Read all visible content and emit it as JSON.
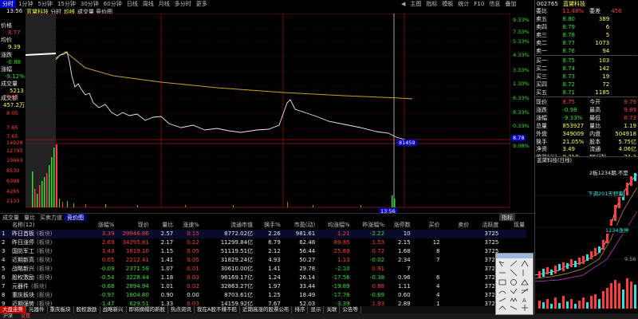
{
  "period_tabs": [
    "分时",
    "1分钟",
    "5分钟",
    "15分钟",
    "30分钟",
    "60分钟",
    "日线",
    "周线",
    "月线",
    "多分时",
    "更多"
  ],
  "toolbar_right": [
    "主图",
    "指标",
    "模板",
    "统计",
    "F10",
    "信息",
    "叠加"
  ],
  "title_row": {
    "time": "13:56",
    "stock_name": "蓝黛科技",
    "tab1": "分时",
    "tab2": "均线",
    "tab3": "成交量",
    "tab4": "竞价图"
  },
  "left_panel": {
    "price_label": "价格",
    "price_val": "8.77",
    "avg_label": "均价",
    "avg_val": "9.39",
    "chg_label": "涨跌",
    "chg_val": "-0.88",
    "pct_label": "涨幅",
    "pct_val": "-9.12%",
    "vol_label": "成交量",
    "vol_val": "5213",
    "amt_label": "成交额",
    "amt_val": "457.2万"
  },
  "price_axis_left": [
    "9.68",
    "9.47",
    "9.27",
    "9.07",
    "8.86",
    "8.66",
    "8.46",
    "8.26",
    "8.05",
    "7.85",
    "7.65"
  ],
  "price_axis_right": [
    "0.33%",
    "1.30%",
    "3.33%",
    "4.33%",
    "5.33%",
    "6.33%",
    "7.33%",
    "8.33%",
    "9.33%"
  ],
  "cur_price_tag": "8.78",
  "cur_pct_tag": "9.08%",
  "vol_axis": [
    "14928",
    "12795",
    "10663",
    "8530",
    "6398",
    "4265",
    "2133"
  ],
  "time_ticks": [
    "10:30",
    "13:00",
    "14:00",
    "15:00"
  ],
  "cursor_time": "13:56",
  "cursor_vol": "81459",
  "bottom_tabs": [
    "成交量",
    "量比",
    "买卖力道",
    "竞价图"
  ],
  "indicator_btn": "指标",
  "table": {
    "headers": [
      "名称(12)",
      "涨幅%",
      "现价",
      "量比",
      "涨速%",
      "流通市值",
      "换手%",
      "市盈(动)",
      "均涨幅%",
      "昨涨幅%",
      "涨停数",
      "买价",
      "卖价",
      "活跃度",
      "现量"
    ],
    "rows": [
      [
        "昨日首板",
        "(板块)",
        "3.39",
        "29946.86",
        "2.57",
        "0.15",
        "8772.02亿",
        "2.26",
        "981.61",
        "1.21",
        "-2.22",
        "10",
        "",
        "",
        "3725"
      ],
      [
        "昨日涨停",
        "(板块)",
        "2.69",
        "34295.81",
        "2.17",
        "0.12",
        "11299.84亿",
        "6.79",
        "62.48",
        "89.85",
        "1.53",
        "2.15",
        "12",
        "",
        "3725"
      ],
      [
        "国防军工",
        "(板块)",
        "1.43",
        "1819.10",
        "1.15",
        "0.05",
        "51119.51亿",
        "2.12",
        "56.44",
        "25.69",
        "0.72",
        "1.68",
        "8",
        "",
        "3725"
      ],
      [
        "近期新高",
        "(板块)",
        "0.05",
        "2212.41",
        "1.41",
        "0.05",
        "31829.24亿",
        "4.93",
        "50.27",
        "1.13",
        "-0.02",
        "2.34",
        "7",
        "",
        "3725"
      ],
      [
        "战略新兴",
        "(板块)",
        "-0.09",
        "2371.59",
        "1.07",
        "0.01",
        "30610.00亿",
        "1.41",
        "29.78",
        "-2.10",
        "0.91",
        "7",
        "",
        "",
        "3725"
      ],
      [
        "股权激励",
        "(板块)",
        "-0.54",
        "3228.44",
        "1.18",
        "0.03",
        "96169.17亿",
        "1.24",
        "26.14",
        "-17.56",
        "-0.38",
        "0.96",
        "6",
        "",
        "3725"
      ],
      [
        "元器件",
        "(板块)",
        "-0.68",
        "2894.94",
        "1.01",
        "0.02",
        "32863.27亿",
        "1.97",
        "33.44",
        "-19.89",
        "0.88",
        "1.11",
        "4",
        "",
        "3725"
      ],
      [
        "重庆板块",
        "(板块)",
        "-0.97",
        "1804.80",
        "0.90",
        "0.00",
        "8703.61亿",
        "1.25",
        "18.49",
        "-17.78",
        "-0.69",
        "0.60",
        "4",
        "",
        "3725"
      ],
      [
        "近期强势",
        "(板块)",
        "-1.47",
        "629.51",
        "1.33",
        "0.03",
        "14159.92亿",
        "7.67",
        "52.03",
        "-3.39",
        "1.93",
        "2.89",
        "1",
        "",
        "3725"
      ]
    ]
  },
  "bottom_bar": [
    "大盘走势",
    "元器件",
    "重庆板块",
    "股权激励",
    "战略新兴",
    "即将摘帽的新股",
    "热点资讯",
    "我在A股不赚不赔",
    "近期高涨的股票公布",
    "排序",
    "显示",
    "关联",
    "公告等"
  ],
  "statusbar": [
    "沪深",
    "设置"
  ],
  "quote": {
    "code": "002765",
    "name": "蓝黛科技",
    "wb_label": "委比",
    "wb_val": "11.48%",
    "wc_label": "委差",
    "wc_val": "456",
    "sell": [
      [
        "卖五",
        "8.80",
        "389"
      ],
      [
        "卖四",
        "8.79",
        "6"
      ],
      [
        "卖三",
        "8.78",
        "5"
      ],
      [
        "卖二",
        "8.77",
        "1073"
      ],
      [
        "卖一",
        "8.76",
        "94"
      ]
    ],
    "buy": [
      [
        "买一",
        "8.75",
        "103"
      ],
      [
        "买二",
        "8.74",
        "142"
      ],
      [
        "买三",
        "8.73",
        "19"
      ],
      [
        "买四",
        "8.72",
        "72"
      ],
      [
        "买五",
        "8.71",
        "1185"
      ]
    ],
    "info": [
      [
        "现价",
        "8.75",
        "今开",
        "9.79"
      ],
      [
        "涨跌",
        "-0.98",
        "最高",
        "9.89"
      ],
      [
        "涨幅",
        "-9.33%",
        "最低",
        "8.73"
      ],
      [
        "总量",
        "853927",
        "量比",
        "1.19"
      ],
      [
        "外盘",
        "349009",
        "内盘",
        "504918"
      ],
      [
        "换手",
        "21.05%",
        "股本",
        "5.75亿"
      ],
      [
        "净资",
        "3.49",
        "流通",
        "4.06亿"
      ],
      [
        "收益(三)",
        "0.310",
        "PE(动)",
        "21.3"
      ]
    ],
    "k_label": "蓝黛科技(日线)",
    "annot1": "2板1234期,不是",
    "annot2": "下调201天积蓄",
    "annot3": "1234涨停",
    "sub_val": "9.56"
  }
}
